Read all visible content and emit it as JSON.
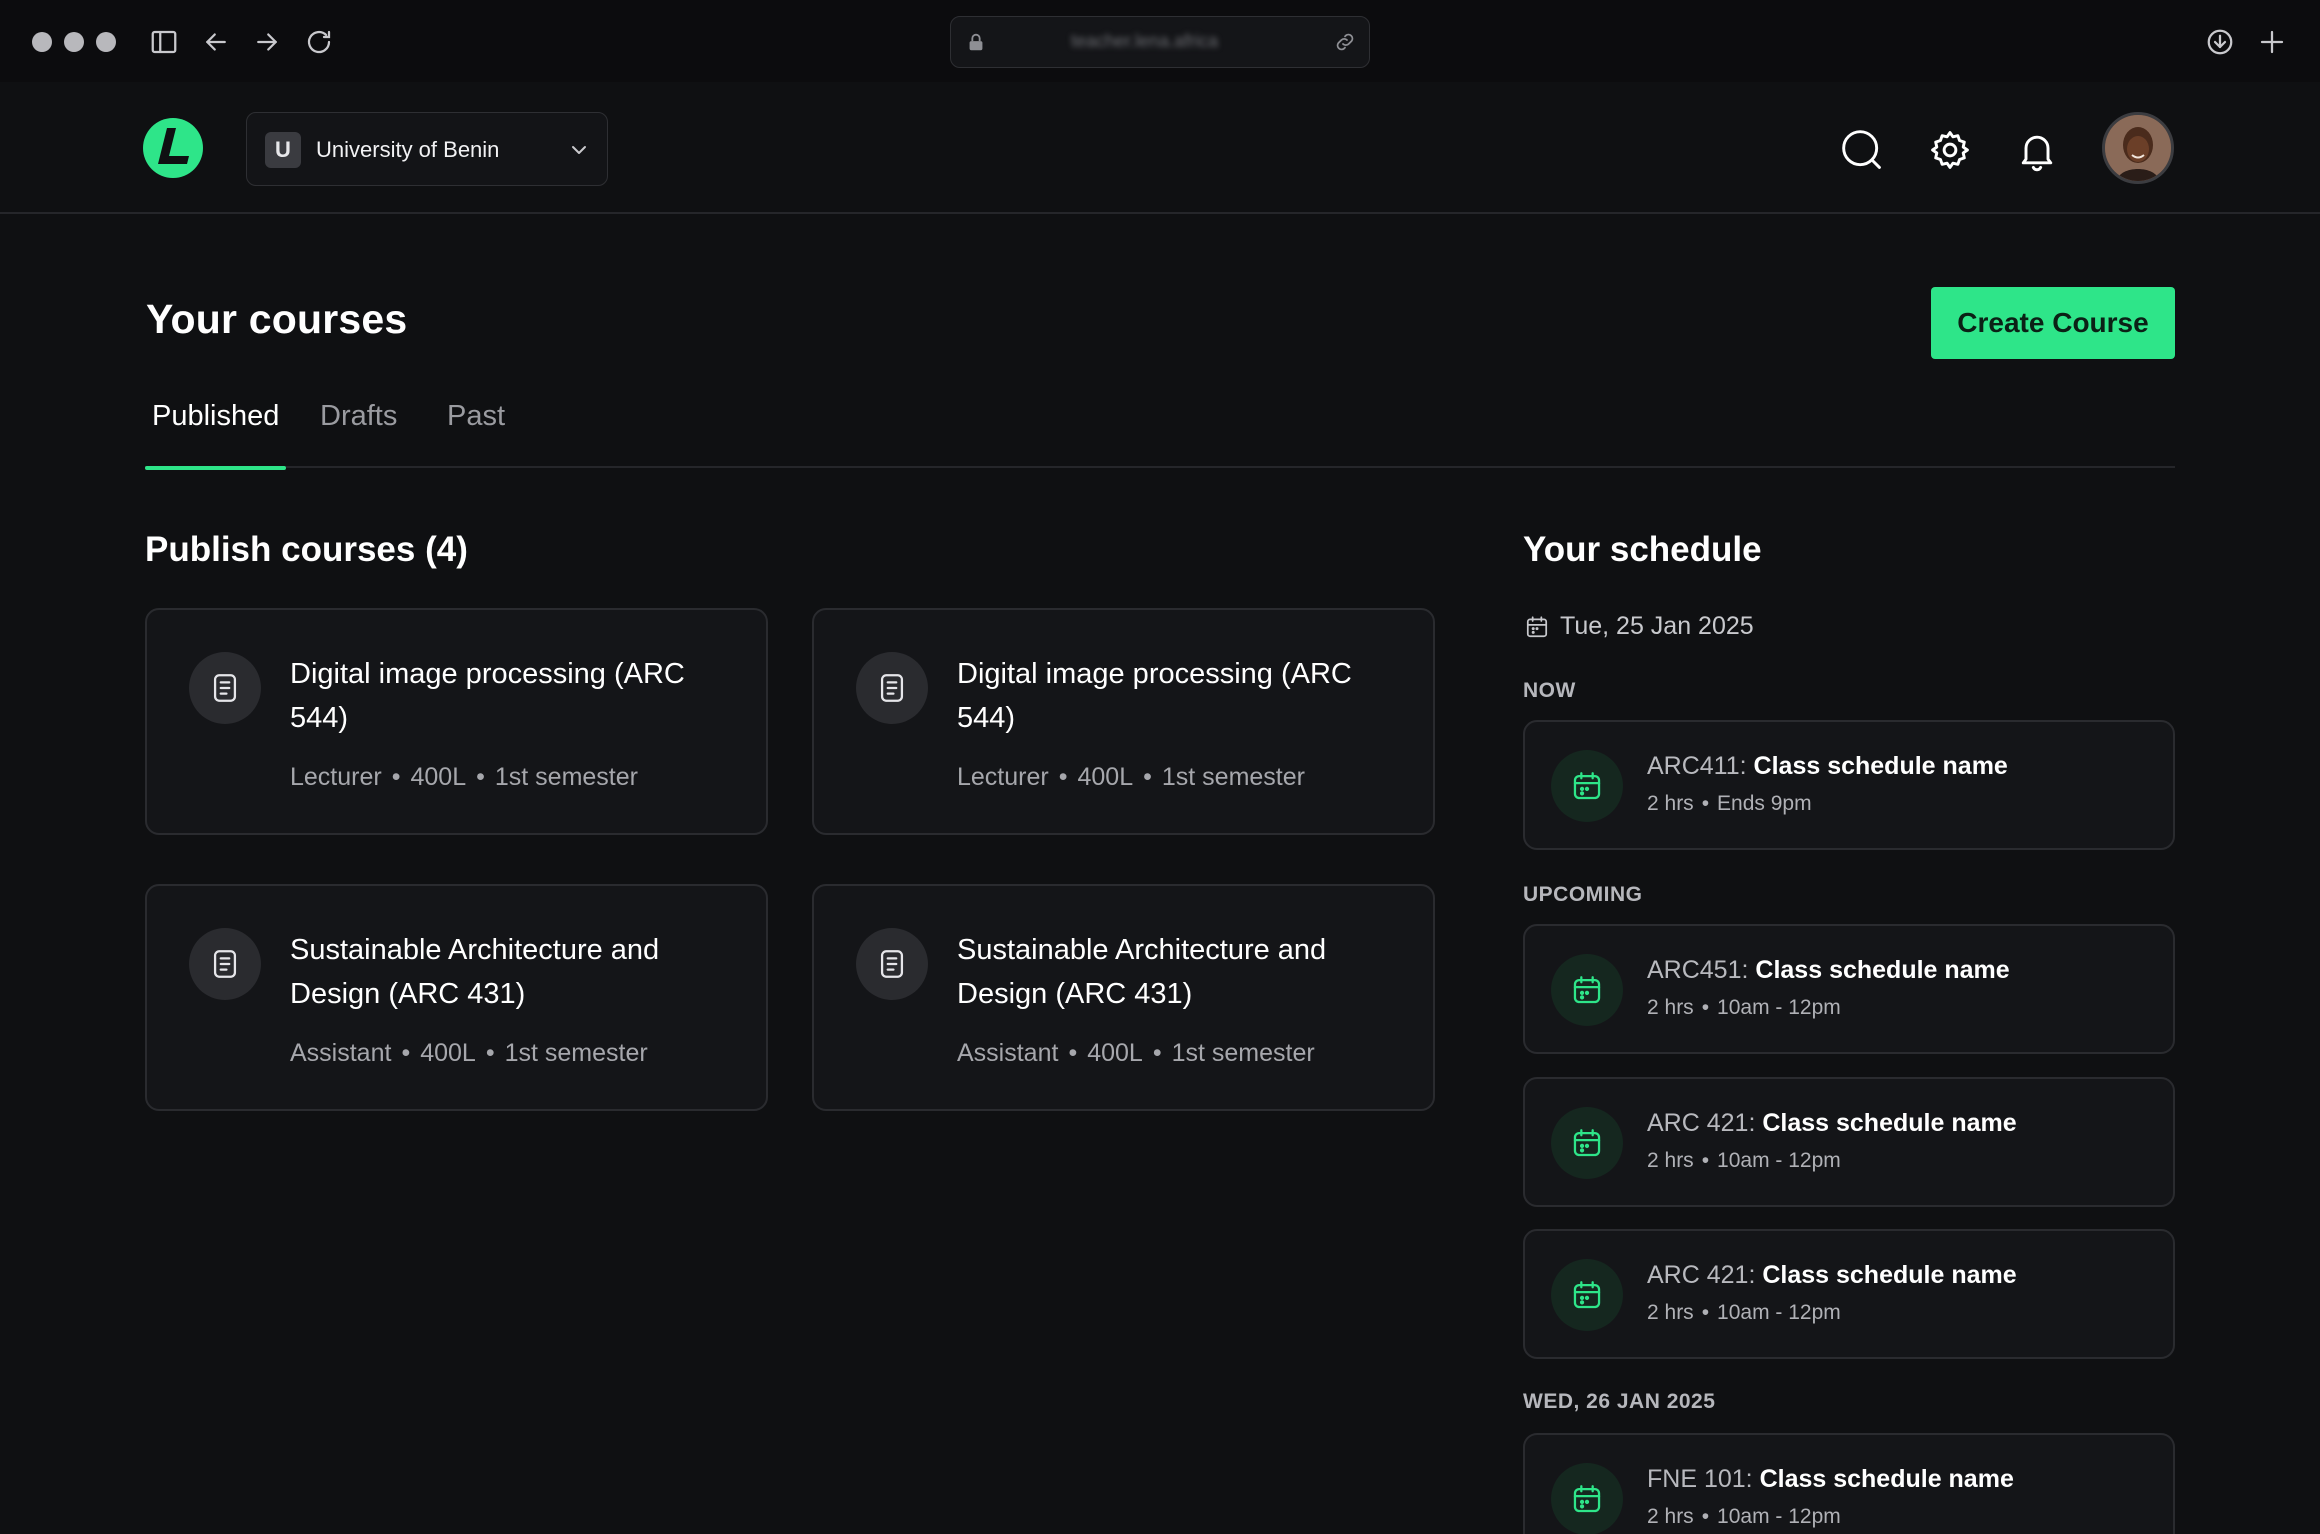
{
  "browser": {
    "url": "teacher.lena.africa"
  },
  "header": {
    "university": {
      "badge": "U",
      "name": "University of Benin"
    }
  },
  "page": {
    "title": "Your courses",
    "create_button": "Create Course"
  },
  "tabs": [
    {
      "label": "Published",
      "active": true
    },
    {
      "label": "Drafts",
      "active": false
    },
    {
      "label": "Past",
      "active": false
    }
  ],
  "courses": {
    "heading": "Publish courses (4)",
    "items": [
      {
        "title": "Digital image processing (ARC 544)",
        "role": "Lecturer",
        "level": "400L",
        "semester": "1st semester"
      },
      {
        "title": "Digital image processing (ARC 544)",
        "role": "Lecturer",
        "level": "400L",
        "semester": "1st semester"
      },
      {
        "title": "Sustainable Architecture and Design (ARC 431)",
        "role": "Assistant",
        "level": "400L",
        "semester": "1st semester"
      },
      {
        "title": "Sustainable Architecture and Design (ARC 431)",
        "role": "Assistant",
        "level": "400L",
        "semester": "1st semester"
      }
    ]
  },
  "schedule": {
    "heading": "Your schedule",
    "date": "Tue, 25 Jan 2025",
    "now_label": "NOW",
    "upcoming_label": "UPCOMING",
    "next_day_label": "WED, 26 JAN 2025",
    "items": [
      {
        "code": "ARC411:",
        "name": "Class schedule name",
        "duration": "2 hrs",
        "time": "Ends 9pm"
      },
      {
        "code": "ARC451:",
        "name": "Class schedule name",
        "duration": "2 hrs",
        "time": "10am - 12pm"
      },
      {
        "code": "ARC 421:",
        "name": "Class schedule name",
        "duration": "2 hrs",
        "time": "10am - 12pm"
      },
      {
        "code": "ARC 421:",
        "name": "Class schedule name",
        "duration": "2 hrs",
        "time": "10am - 12pm"
      },
      {
        "code": "FNE 101:",
        "name": "Class schedule name",
        "duration": "2 hrs",
        "time": "10am - 12pm"
      }
    ]
  },
  "colors": {
    "accent": "#2ee589",
    "background": "#0f1012",
    "card": "#141518",
    "border": "#2a2b2f"
  }
}
